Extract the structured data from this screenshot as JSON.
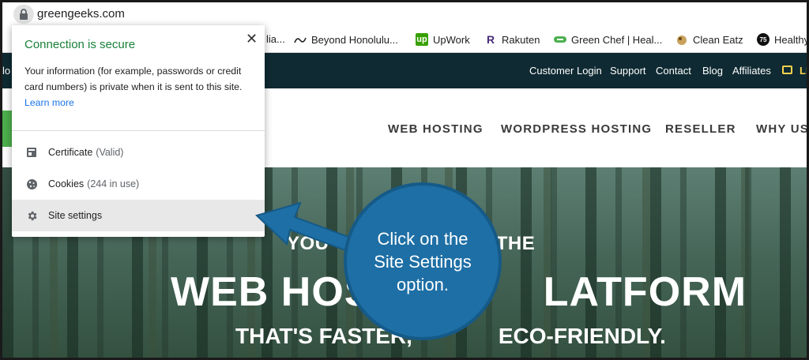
{
  "browser": {
    "url": "greengeeks.com"
  },
  "bookmarks": [
    {
      "label": "lia...",
      "icon": "bookmark-icon"
    },
    {
      "label": "Beyond Honolulu...",
      "icon": "wave-icon"
    },
    {
      "label": "UpWork",
      "icon": "upwork-icon",
      "icon_text": "up",
      "color": "#37a000"
    },
    {
      "label": "Rakuten",
      "icon": "rakuten-icon",
      "icon_text": "R",
      "color": "#4a2a7a"
    },
    {
      "label": "Green Chef | Heal...",
      "icon": "greenchef-icon",
      "color": "#4caf50"
    },
    {
      "label": "Clean Eatz",
      "icon": "cleaneatz-icon"
    },
    {
      "label": "Healthy",
      "icon": "healthy-icon",
      "icon_text": "75"
    }
  ],
  "topnav": {
    "left_fragment": "lo",
    "links": [
      "Customer Login",
      "Support",
      "Contact",
      "Blog",
      "Affiliates"
    ],
    "chat": "LIV"
  },
  "mainnav": {
    "items": [
      "WEB HOSTING",
      "WORDPRESS HOSTING",
      "RESELLER",
      "WHY US"
    ]
  },
  "hero": {
    "line1": "YOU                    S ON THE",
    "line2": "WEB HOS              LATFORM",
    "line3": "THAT'S FASTER,              ECO-FRIENDLY."
  },
  "popup": {
    "title": "Connection is secure",
    "close": "✕",
    "description": "Your information (for example, passwords or credit card numbers) is private when it is sent to this site.",
    "learn_more": "Learn more",
    "rows": [
      {
        "label": "Certificate",
        "sub": "(Valid)",
        "icon": "certificate-icon"
      },
      {
        "label": "Cookies",
        "sub": "(244 in use)",
        "icon": "cookie-icon"
      },
      {
        "label": "Site settings",
        "sub": "",
        "icon": "gear-icon",
        "highlighted": true
      }
    ]
  },
  "callout": {
    "lines": [
      "Click on the",
      "Site Settings",
      "option."
    ],
    "color": "#1e6fa5"
  }
}
